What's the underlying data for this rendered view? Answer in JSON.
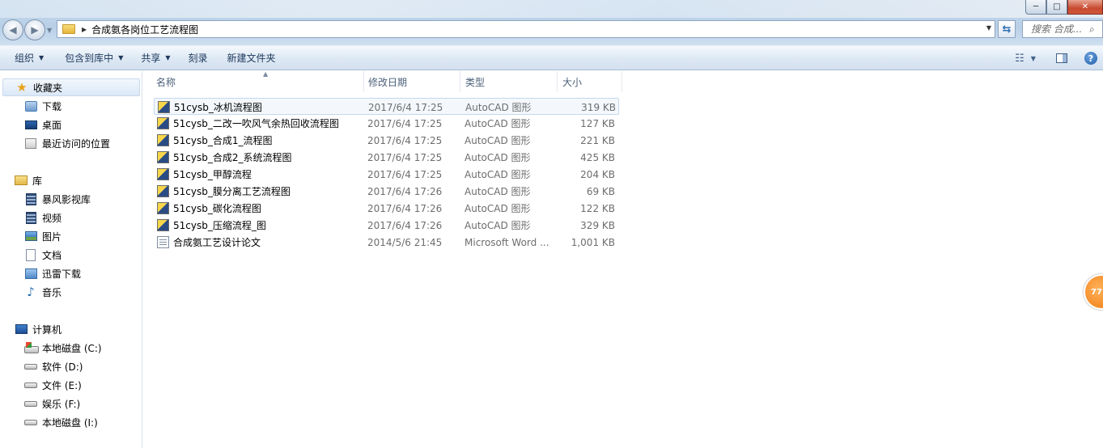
{
  "window": {
    "minimize_glyph": "─",
    "maximize_glyph": "□",
    "close_glyph": "✕"
  },
  "address": {
    "path": "合成氨各岗位工艺流程图",
    "search_placeholder": "搜索 合成..."
  },
  "toolbar": {
    "organize": "组织",
    "include_in_library": "包含到库中",
    "share": "共享",
    "burn": "刻录",
    "new_folder": "新建文件夹"
  },
  "sidebar": {
    "favorites": {
      "label": "收藏夹",
      "items": [
        {
          "label": "下载",
          "icon": "download-folder-icon"
        },
        {
          "label": "桌面",
          "icon": "desktop-icon"
        },
        {
          "label": "最近访问的位置",
          "icon": "recent-places-icon"
        }
      ]
    },
    "libraries": {
      "label": "库",
      "items": [
        {
          "label": "暴风影视库",
          "icon": "video-library-icon"
        },
        {
          "label": "视频",
          "icon": "videos-icon"
        },
        {
          "label": "图片",
          "icon": "pictures-icon"
        },
        {
          "label": "文档",
          "icon": "documents-icon"
        },
        {
          "label": "迅雷下载",
          "icon": "thunder-download-icon"
        },
        {
          "label": "音乐",
          "icon": "music-icon"
        }
      ]
    },
    "computer": {
      "label": "计算机",
      "items": [
        {
          "label": "本地磁盘 (C:)",
          "icon": "system-drive-icon"
        },
        {
          "label": "软件 (D:)",
          "icon": "drive-icon"
        },
        {
          "label": "文件 (E:)",
          "icon": "drive-icon"
        },
        {
          "label": "娱乐 (F:)",
          "icon": "drive-icon"
        },
        {
          "label": "本地磁盘 (I:)",
          "icon": "drive-icon"
        }
      ]
    }
  },
  "columns": {
    "name": "名称",
    "modified": "修改日期",
    "type": "类型",
    "size": "大小"
  },
  "files": [
    {
      "name": "51cysb_冰机流程图",
      "modified": "2017/6/4 17:25",
      "type": "AutoCAD 图形",
      "size": "319 KB",
      "icon": "autocad-file-icon"
    },
    {
      "name": "51cysb_二改一吹风气余热回收流程图",
      "modified": "2017/6/4 17:25",
      "type": "AutoCAD 图形",
      "size": "127 KB",
      "icon": "autocad-file-icon"
    },
    {
      "name": "51cysb_合成1_流程图",
      "modified": "2017/6/4 17:25",
      "type": "AutoCAD 图形",
      "size": "221 KB",
      "icon": "autocad-file-icon"
    },
    {
      "name": "51cysb_合成2_系统流程图",
      "modified": "2017/6/4 17:25",
      "type": "AutoCAD 图形",
      "size": "425 KB",
      "icon": "autocad-file-icon"
    },
    {
      "name": "51cysb_甲醇流程",
      "modified": "2017/6/4 17:25",
      "type": "AutoCAD 图形",
      "size": "204 KB",
      "icon": "autocad-file-icon"
    },
    {
      "name": "51cysb_膜分离工艺流程图",
      "modified": "2017/6/4 17:26",
      "type": "AutoCAD 图形",
      "size": "69 KB",
      "icon": "autocad-file-icon"
    },
    {
      "name": "51cysb_碳化流程图",
      "modified": "2017/6/4 17:26",
      "type": "AutoCAD 图形",
      "size": "122 KB",
      "icon": "autocad-file-icon"
    },
    {
      "name": "51cysb_压缩流程_图",
      "modified": "2017/6/4 17:26",
      "type": "AutoCAD 图形",
      "size": "329 KB",
      "icon": "autocad-file-icon"
    },
    {
      "name": "合成氨工艺设计论文",
      "modified": "2014/5/6 21:45",
      "type": "Microsoft Word ...",
      "size": "1,001 KB",
      "icon": "word-document-icon"
    }
  ],
  "floater": {
    "label": "77"
  }
}
